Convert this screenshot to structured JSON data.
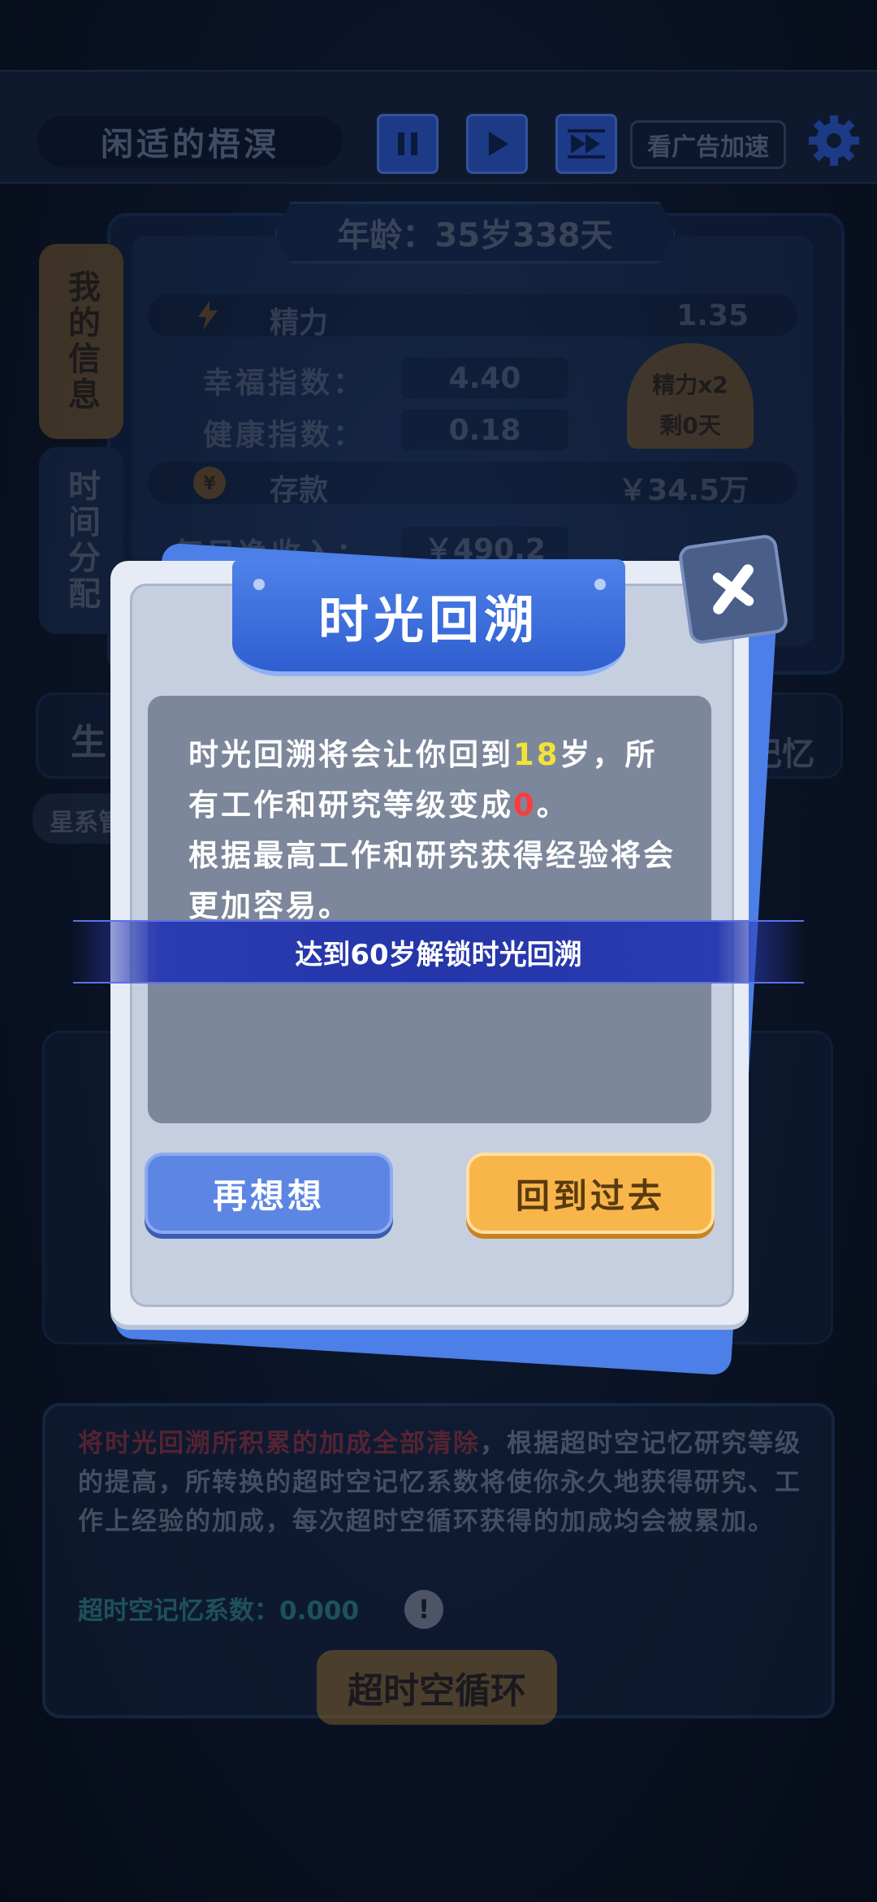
{
  "header": {
    "player_name": "闲适的梧溟",
    "ad_button": "看广告加速"
  },
  "info": {
    "age": "年龄：35岁338天",
    "tab_my_info": "我的信息",
    "tab_time_alloc": "时间分配",
    "energy_label": "精力",
    "energy_value": "1.35",
    "happiness_label": "幸福指数：",
    "happiness_value": "4.40",
    "health_label": "健康指数：",
    "health_value": "0.18",
    "energy_badge_title": "精力x2",
    "energy_badge_sub": "剩0天",
    "savings_label": "存款",
    "savings_value": "￥34.5万",
    "daily_income_label": "每日净收入：",
    "daily_income_value": "￥490.2",
    "left_tab_fragment": "生",
    "right_tab_fragment": "记忆",
    "galaxy_fragment": "星系管"
  },
  "lower": {
    "text_red": "将时光回溯所积累的加成全部清除",
    "text_rest": "，根据超时空记忆研究等级的提高，所转换的超时空记忆系数将使你永久地获得研究、工作上经验的加成，每次超时空循环获得的加成均会被累加。",
    "coefficient": "超时空记忆系数：0.000",
    "loop_button": "超时空循环"
  },
  "modal": {
    "title": "时光回溯",
    "text_part1": "时光回溯将会让你回到",
    "age_highlight": "18",
    "text_part2": "岁，所有工作和研究等级变成",
    "level_highlight": "0",
    "text_part3": "。",
    "text_line3": "根据最高工作和研究获得经验将会更加容易。",
    "unlock_notice": "达到60岁解锁时光回溯",
    "cancel_button": "再想想",
    "confirm_button": "回到过去"
  },
  "colors": {
    "accent_blue": "#4f82ea",
    "confirm_orange": "#f8b64a",
    "highlight_yellow": "#f1e23c",
    "highlight_red": "#ff3b3b"
  }
}
